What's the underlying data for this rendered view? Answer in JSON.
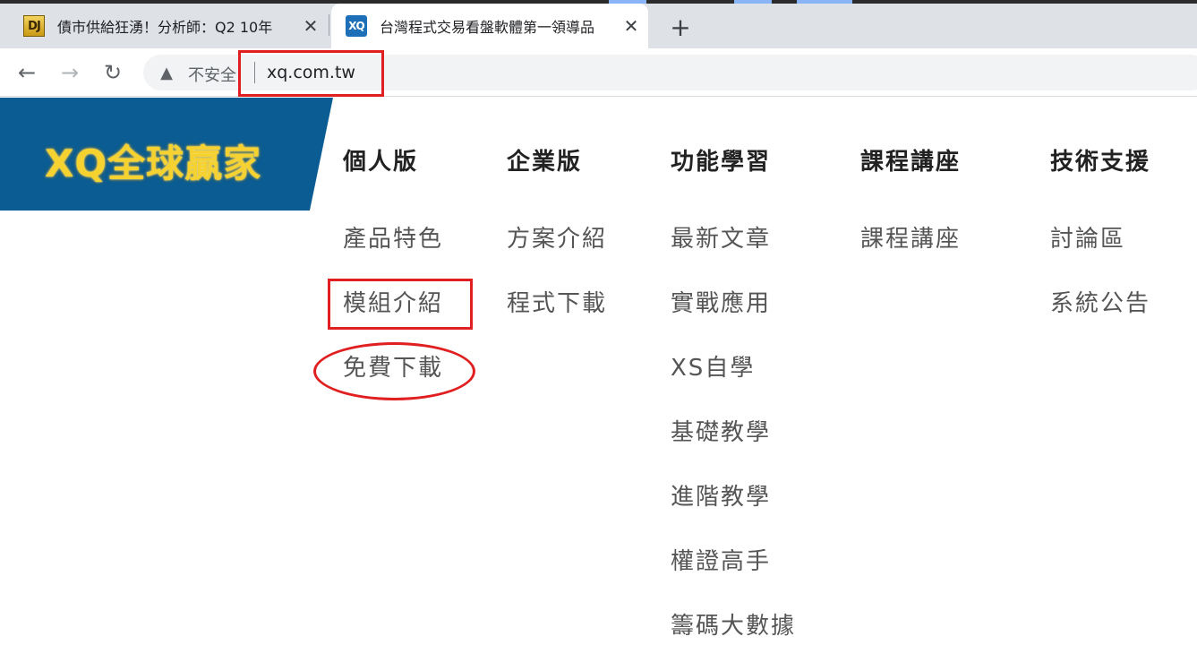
{
  "browser": {
    "tabs": [
      {
        "favicon": "DJ",
        "title": "債市供給狂湧！分析師：Q2 10年",
        "active": false
      },
      {
        "favicon": "XQ",
        "title": "台灣程式交易看盤軟體第一領導品",
        "active": true
      }
    ],
    "new_tab": "+",
    "security_label": "不安全",
    "url": "xq.com.tw"
  },
  "site": {
    "logo": "XQ全球贏家",
    "nav": [
      {
        "heading": "個人版",
        "items": [
          "產品特色",
          "模組介紹",
          "免費下載"
        ]
      },
      {
        "heading": "企業版",
        "items": [
          "方案介紹",
          "程式下載"
        ]
      },
      {
        "heading": "功能學習",
        "items": [
          "最新文章",
          "實戰應用",
          "XS自學",
          "基礎教學",
          "進階教學",
          "權證高手",
          "籌碼大數據"
        ]
      },
      {
        "heading": "課程講座",
        "items": [
          "課程講座"
        ]
      },
      {
        "heading": "技術支援",
        "items": [
          "討論區",
          "系統公告"
        ]
      }
    ]
  },
  "colors": {
    "logo_bg": "#0a5c93",
    "logo_text": "#f5d230",
    "annotation": "#e02020"
  }
}
